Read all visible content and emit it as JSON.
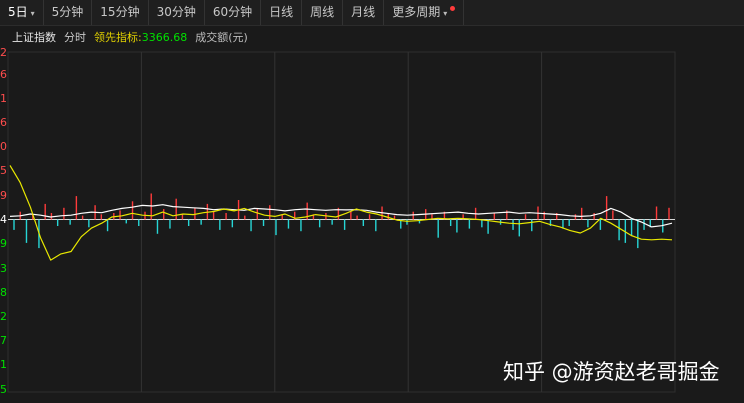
{
  "toolbar": {
    "tabs": [
      {
        "label": "5日",
        "caret": "▾",
        "active": true
      },
      {
        "label": "5分钟"
      },
      {
        "label": "15分钟"
      },
      {
        "label": "30分钟"
      },
      {
        "label": "60分钟"
      },
      {
        "label": "日线"
      },
      {
        "label": "周线"
      },
      {
        "label": "月线"
      },
      {
        "label": "更多周期",
        "caret": "▾",
        "notification_dot": true
      }
    ]
  },
  "info": {
    "index_name": "上证指数",
    "timeframe": "分时",
    "indicator_label": "领先指标:",
    "indicator_value": "3366.68",
    "volume_label": "成交额(元)"
  },
  "y_axis_labels": [
    {
      "text": "2",
      "color": "#ff4d4d"
    },
    {
      "text": "6",
      "color": "#ff4d4d"
    },
    {
      "text": "1",
      "color": "#ff4d4d"
    },
    {
      "text": "6",
      "color": "#ff4d4d"
    },
    {
      "text": "0",
      "color": "#ff4d4d"
    },
    {
      "text": "5",
      "color": "#ff4d4d"
    },
    {
      "text": "9",
      "color": "#ff4d4d"
    },
    {
      "text": "4",
      "color": "#ffffff"
    },
    {
      "text": "9",
      "color": "#00e000"
    },
    {
      "text": "3",
      "color": "#00e000"
    },
    {
      "text": "8",
      "color": "#00e000"
    },
    {
      "text": "2",
      "color": "#00e000"
    },
    {
      "text": "7",
      "color": "#00e000"
    },
    {
      "text": "1",
      "color": "#00e000"
    },
    {
      "text": "5",
      "color": "#00e000"
    }
  ],
  "chart_data": {
    "type": "line",
    "days": 5,
    "grid": true,
    "series": [
      {
        "color": "#ffffff",
        "values": [
          0.25,
          0.3,
          0.45,
          0.35,
          0.2,
          0.3,
          0.35,
          0.5,
          0.6,
          0.55,
          0.75,
          0.9,
          1.0,
          1.15,
          1.1,
          1.2,
          1.05,
          1.0,
          0.95,
          0.9,
          0.8,
          0.85,
          0.8,
          0.75,
          0.9,
          0.85,
          0.8,
          0.7,
          0.8,
          0.85,
          0.8,
          0.75,
          0.8,
          0.78,
          0.8,
          0.75,
          0.6,
          0.5,
          0.4,
          0.35,
          0.4,
          0.45,
          0.5,
          0.55,
          0.6,
          0.5,
          0.45,
          0.5,
          0.55,
          0.6,
          0.5,
          0.55,
          0.5,
          0.45,
          0.4,
          0.3,
          0.25,
          0.3,
          0.5,
          0.9,
          0.6,
          0.1,
          -0.2,
          -0.6,
          -0.5,
          -0.3
        ]
      },
      {
        "color": "#e8e800",
        "values": [
          4.4,
          3.0,
          1.0,
          -1.5,
          -3.3,
          -2.8,
          -2.6,
          -1.4,
          -0.7,
          -0.3,
          0.2,
          0.3,
          0.5,
          0.35,
          0.3,
          0.6,
          0.3,
          0.45,
          0.4,
          0.55,
          0.65,
          0.85,
          0.7,
          0.9,
          0.6,
          0.35,
          0.25,
          0.45,
          0.1,
          0.2,
          0.4,
          0.3,
          0.2,
          0.5,
          0.85,
          0.6,
          0.45,
          0.2,
          -0.05,
          -0.15,
          -0.1,
          0.0,
          0.1,
          0.05,
          0.1,
          0.05,
          0.0,
          -0.1,
          -0.2,
          -0.3,
          -0.35,
          -0.25,
          -0.15,
          -0.4,
          -0.6,
          -0.9,
          -1.1,
          -0.7,
          0.1,
          -0.3,
          -0.8,
          -1.3,
          -1.6,
          -1.65,
          -1.6,
          -1.65
        ]
      }
    ],
    "bars": [
      -0.8,
      0.6,
      -1.8,
      0.4,
      -2.2,
      1.2,
      0.5,
      -0.5,
      0.9,
      -0.4,
      1.8,
      0.3,
      -0.6,
      1.1,
      0.4,
      -0.9,
      0.5,
      0.7,
      -0.3,
      1.4,
      -0.5,
      0.6,
      2.0,
      -1.1,
      0.8,
      -0.7,
      1.6,
      0.4,
      -0.5,
      0.9,
      -0.4,
      1.2,
      0.6,
      -0.8,
      0.5,
      -0.6,
      1.5,
      0.3,
      -0.9,
      0.8,
      -0.5,
      1.1,
      -1.2,
      0.4,
      -0.7,
      0.6,
      -0.9,
      1.3,
      0.4,
      -0.6,
      0.5,
      -0.4,
      0.9,
      -0.8,
      0.6,
      0.3,
      -0.5,
      0.4,
      -0.9,
      1.0,
      0.5,
      0.3,
      -0.7,
      -0.4,
      0.6,
      -0.3,
      0.8,
      0.4,
      -1.4,
      0.6,
      -0.5,
      -1.0,
      0.4,
      -0.7,
      0.9,
      -0.6,
      -1.1,
      0.5,
      -0.4,
      0.7,
      -0.8,
      -1.3,
      0.4,
      -0.9,
      1.0,
      0.6,
      -0.5,
      0.5,
      -0.7,
      -0.5,
      0.4,
      0.9,
      -0.6,
      0.5,
      -0.8,
      1.8,
      0.7,
      -1.6,
      -1.8,
      -1.2,
      -2.2,
      -0.8,
      -0.6,
      1.0,
      -1.0,
      0.9
    ],
    "up_color": "#ff3b3b",
    "down_color": "#27d6d6"
  },
  "watermark": "知乎 @游资赵老哥掘金"
}
